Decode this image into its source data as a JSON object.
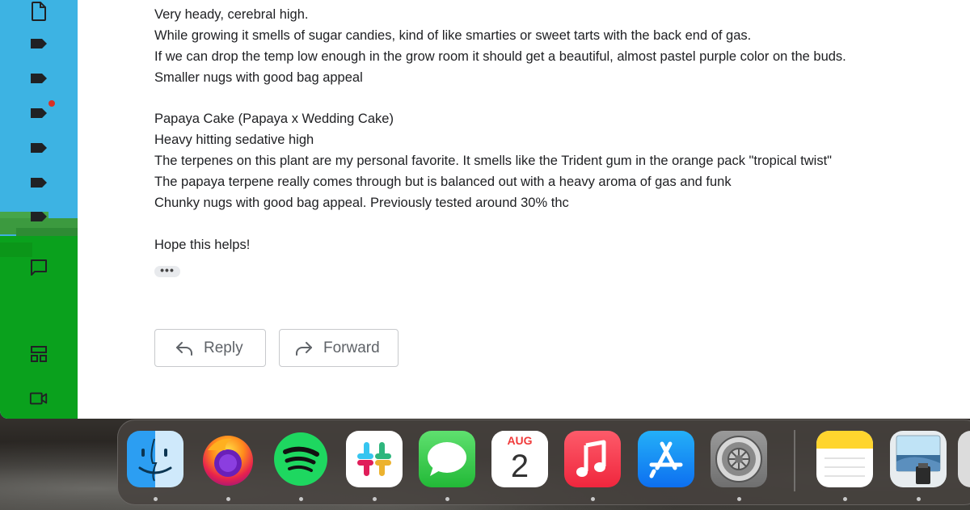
{
  "email": {
    "lines": [
      "Very heady, cerebral high.",
      "While growing it smells of sugar candies, kind of like smarties or sweet tarts with the back end of gas.",
      "If we can drop the temp low enough in the grow room it should get a beautiful, almost pastel purple color on the buds.",
      "Smaller nugs with good bag appeal",
      "",
      "Papaya Cake (Papaya x Wedding Cake)",
      "Heavy hitting sedative high",
      "The terpenes on this plant are my personal favorite. It smells like the Trident gum in the orange pack \"tropical twist\"",
      "The papaya terpene really comes through but is balanced out with a heavy aroma of gas and funk",
      "Chunky nugs with good bag appeal. Previously tested around 30% thc",
      "",
      "Hope this helps!"
    ],
    "trimmed_content": "•••"
  },
  "actions": {
    "reply_label": "Reply",
    "forward_label": "Forward"
  },
  "rail": {
    "icons": [
      "document-icon",
      "label-icon",
      "label-icon",
      "label-icon",
      "label-icon",
      "label-icon",
      "label-icon",
      "chat-icon",
      "spaces-icon",
      "video-icon"
    ],
    "notification_color": "#d93025"
  },
  "dock": {
    "apps": [
      "Finder",
      "Firefox",
      "Spotify",
      "Slack",
      "Messages",
      "Calendar",
      "Music",
      "App Store",
      "System Preferences",
      "Notes",
      "Preview"
    ],
    "calendar": {
      "month": "AUG",
      "day": "2"
    }
  },
  "colors": {
    "text": "#202124",
    "button_text": "#5f6368",
    "button_border": "#c7c9cc"
  }
}
